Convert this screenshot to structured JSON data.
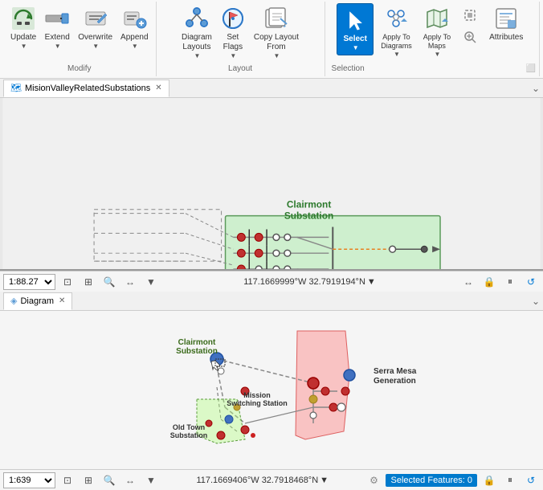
{
  "ribbon": {
    "groups": [
      {
        "id": "modify",
        "label": "Modify",
        "buttons": [
          {
            "id": "update",
            "label": "Update",
            "has_dropdown": true
          },
          {
            "id": "extend",
            "label": "Extend",
            "has_dropdown": true
          },
          {
            "id": "overwrite",
            "label": "Overwrite",
            "has_dropdown": true
          },
          {
            "id": "append",
            "label": "Append",
            "has_dropdown": true
          }
        ]
      },
      {
        "id": "layout",
        "label": "Layout",
        "buttons": [
          {
            "id": "diagram-layouts",
            "label": "Diagram\nLayouts",
            "has_dropdown": true
          },
          {
            "id": "set-flags",
            "label": "Set\nFlags",
            "has_dropdown": true
          },
          {
            "id": "copy-layout",
            "label": "Copy Layout\nFrom",
            "has_dropdown": true
          }
        ]
      },
      {
        "id": "selection",
        "label": "Selection",
        "buttons": [
          {
            "id": "select",
            "label": "Select",
            "active": true,
            "has_dropdown": true
          },
          {
            "id": "apply-to-diagrams",
            "label": "Apply To\nDiagrams",
            "has_dropdown": true
          },
          {
            "id": "apply-to-maps",
            "label": "Apply To\nMaps",
            "has_dropdown": true
          },
          {
            "id": "small1",
            "label": "",
            "small": true
          },
          {
            "id": "attributes",
            "label": "Attributes",
            "has_dropdown": false
          }
        ]
      }
    ]
  },
  "tabs": {
    "top": {
      "items": [
        {
          "id": "mision-valley",
          "label": "MisionValleyRelatedSubstations",
          "icon": "map-icon",
          "closeable": true
        }
      ]
    },
    "bottom": {
      "items": [
        {
          "id": "diagram",
          "label": "Diagram",
          "icon": "diagram-icon",
          "closeable": true
        }
      ]
    }
  },
  "map_top": {
    "zoom": "1:88.27",
    "coordinates": "117.1669999°W 32.7919194°N",
    "labels": {
      "clairmont": "Clairmont\nSubstation"
    }
  },
  "map_bottom": {
    "zoom": "1:639",
    "coordinates": "117.1669406°W 32.7918468°N",
    "selected_features": "Selected Features: 0",
    "labels": {
      "clairmont": "Clairmont\nSubstation",
      "mission": "Mission\nSwitching Station",
      "old_town": "Old Town\nSubstation",
      "serra_mesa": "Serra Mesa\nGeneration"
    }
  }
}
